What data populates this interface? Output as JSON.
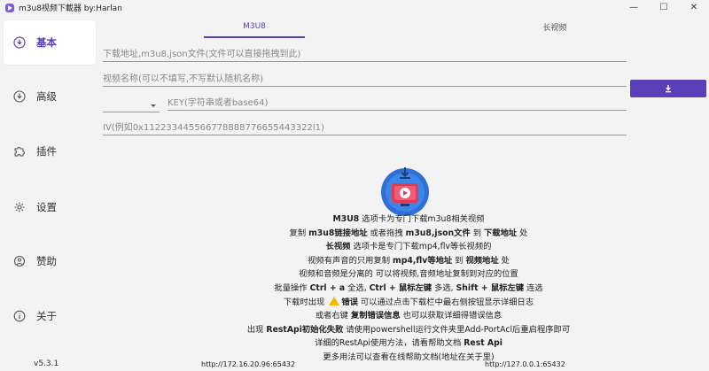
{
  "window": {
    "title": "m3u8视频下載器 by:Harlan",
    "minimize": "—",
    "maximize": "☐",
    "close": "✕"
  },
  "sidebar": {
    "items": [
      {
        "label": "基本",
        "icon": "download-circle-icon"
      },
      {
        "label": "高级",
        "icon": "download-circle-icon"
      },
      {
        "label": "插件",
        "icon": "puzzle-icon"
      },
      {
        "label": "设置",
        "icon": "gear-icon"
      },
      {
        "label": "赞助",
        "icon": "support-icon"
      },
      {
        "label": "关于",
        "icon": "info-icon"
      }
    ],
    "version": "v5.3.1"
  },
  "tabs": [
    {
      "label": "M3U8",
      "active": true
    },
    {
      "label": "长视频",
      "active": false
    }
  ],
  "form": {
    "url_placeholder": "下载地址,m3u8,json文件(文件可以直接拖拽到此)",
    "name_placeholder": "视频名称(可以不填写,不写默认随机名称)",
    "key_placeholder": "KEY(字符串或者base64)",
    "iv_placeholder": "IV(例如0x112233445566778888776655443322l1)",
    "select_value": ""
  },
  "help": {
    "l1": {
      "b1": "M3U8",
      "t1": " 选项卡为专门下载m3u8相关视频"
    },
    "l2": {
      "t1": "复制 ",
      "b1": "m3u8链接地址",
      "t2": " 或者拖拽 ",
      "b2": "m3u8,json文件",
      "t3": " 到 ",
      "b3": "下载地址",
      "t4": " 处"
    },
    "l3": {
      "b1": "长视频",
      "t1": " 选项卡是专门下载mp4,flv等长视频的"
    },
    "l4": {
      "t1": "视频有声音的只用复制 ",
      "b1": "mp4,flv等地址",
      "t2": " 到 ",
      "b2": "视频地址",
      "t3": " 处"
    },
    "l5": {
      "t1": "视频和音频是分离的 可以将视频,音频地址复制到对应的位置"
    },
    "l6": {
      "t1": "批量操作 ",
      "b1": "Ctrl + a",
      "t2": " 全选, ",
      "b2": "Ctrl + 鼠标左键",
      "t3": " 多选, ",
      "b3": "Shift + 鼠标左键",
      "t4": " 连选"
    },
    "l7": {
      "t1": "下载时出现 ",
      "b1": "错误",
      "t2": " 可以通过点击下载栏中最右侧按钮显示详细日志"
    },
    "l8": {
      "t1": "或者右键 ",
      "b1": "复制错误信息",
      "t2": " 也可以获取详细得错误信息"
    },
    "l9": {
      "t1": "出现 ",
      "b1": "RestApi初始化失败",
      "t2": " 请使用powershell运行文件夹里Add-PortAcl后重启程序即可"
    },
    "l10": {
      "t1": "详细的RestApi使用方法，请看帮助文档 ",
      "b1": "Rest Api"
    },
    "l11": {
      "t1": "更多用法可以查看在线帮助文档(地址在关于里)"
    }
  },
  "footer": {
    "left_url": "http://172.16.20.96:65432",
    "right_url": "http://127.0.0.1:65432"
  },
  "colors": {
    "accent": "#5a3fb8",
    "warning": "#f5b700"
  }
}
